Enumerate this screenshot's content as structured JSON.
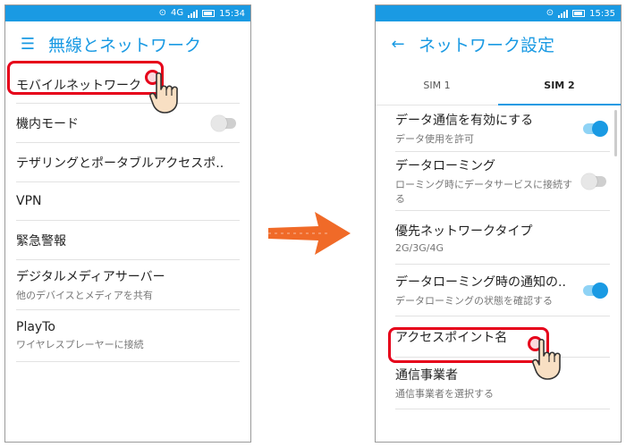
{
  "left": {
    "status": {
      "signal_tag": "4G",
      "time": "15:34"
    },
    "title": "無線とネットワーク",
    "items": [
      {
        "title": "モバイルネットワーク",
        "subtitle": ""
      },
      {
        "title": "機内モード",
        "subtitle": "",
        "toggle": "off"
      },
      {
        "title": "テザリングとポータブルアクセスポ..",
        "subtitle": ""
      },
      {
        "title": "VPN",
        "subtitle": ""
      },
      {
        "title": "緊急警報",
        "subtitle": ""
      },
      {
        "title": "デジタルメディアサーバー",
        "subtitle": "他のデバイスとメディアを共有"
      },
      {
        "title": "PlayTo",
        "subtitle": "ワイヤレスプレーヤーに接続"
      }
    ]
  },
  "right": {
    "status": {
      "time": "15:35"
    },
    "title": "ネットワーク設定",
    "tabs": [
      {
        "label": "SIM 1",
        "active": false
      },
      {
        "label": "SIM 2",
        "active": true
      }
    ],
    "items": [
      {
        "title": "データ通信を有効にする",
        "subtitle": "データ使用を許可",
        "toggle": "on"
      },
      {
        "title": "データローミング",
        "subtitle": "ローミング時にデータサービスに接続する",
        "toggle": "off"
      },
      {
        "title": "優先ネットワークタイプ",
        "subtitle": "2G/3G/4G"
      },
      {
        "title": "データローミング時の通知の..",
        "subtitle": "データローミングの状態を確認する",
        "toggle": "on"
      },
      {
        "title": "アクセスポイント名",
        "subtitle": ""
      },
      {
        "title": "通信事業者",
        "subtitle": "通信事業者を選択する"
      }
    ]
  },
  "colors": {
    "accent": "#1a9ae3",
    "highlight": "#e6001a",
    "arrow": "#f06a28"
  },
  "icons": {
    "left_nav": "menu-icon",
    "right_nav": "back-arrow-icon",
    "transition": "arrow-right-icon"
  }
}
